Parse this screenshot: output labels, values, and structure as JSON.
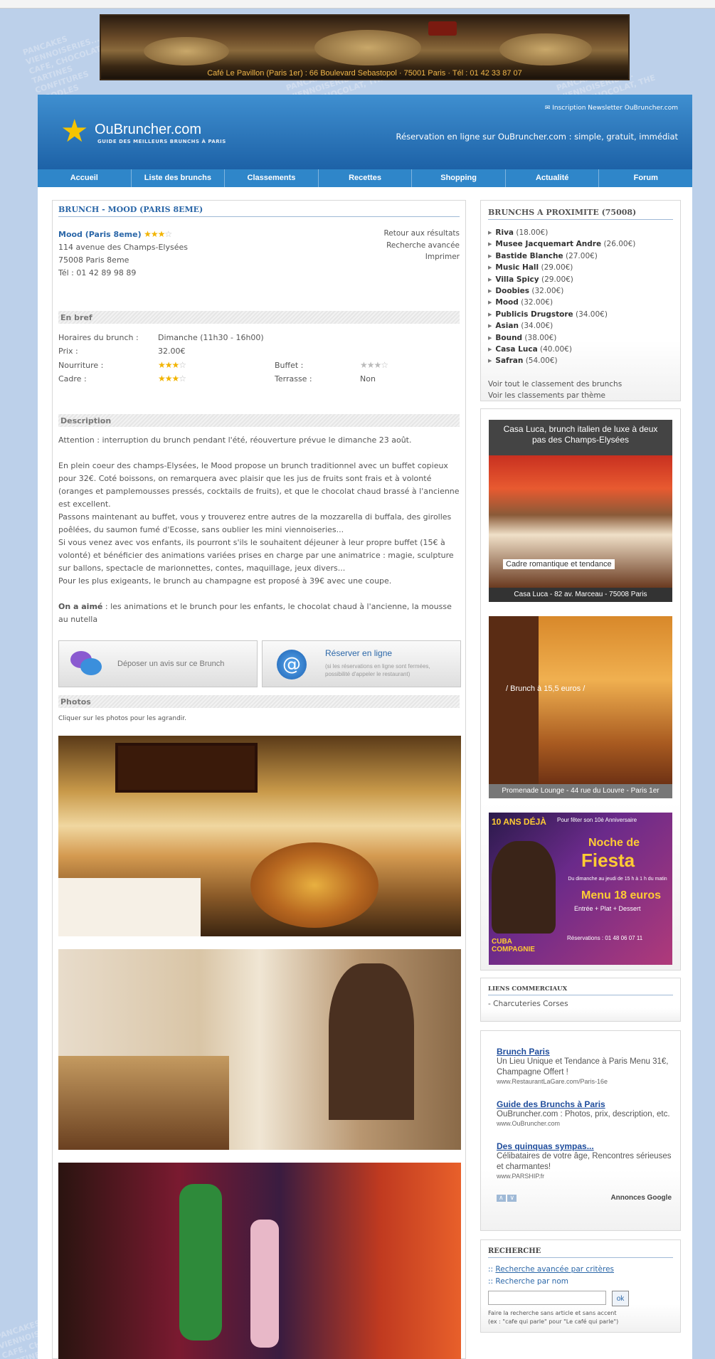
{
  "banner": {
    "caption": "Café Le Pavillon (Paris 1er) : 66 Boulevard Sebastopol · 75001 Paris · Tél : 01 42 33 87 07"
  },
  "background": {
    "words": "PANCAKES\nVIENNOISERIES...\nCAFE, CHOCOLAT, THE\nTARTINES\nCONFITURES\nNOODLES"
  },
  "header": {
    "logo": "OuBruncher.com",
    "logo_sub": "GUIDE DES MEILLEURS BRUNCHS À PARIS",
    "newsletter": "Inscription Newsletter OuBruncher.com",
    "tagline": "Réservation en ligne sur OuBruncher.com : simple, gratuit, immédiat"
  },
  "nav": [
    "Accueil",
    "Liste des brunchs",
    "Classements",
    "Recettes",
    "Shopping",
    "Actualité",
    "Forum"
  ],
  "main": {
    "title": "BRUNCH - MOOD (PARIS 8EME)",
    "name": "Mood (Paris 8eme)",
    "address1": "114 avenue des Champs-Elysées",
    "address2": "75008 Paris 8eme",
    "phone": "Tél : 01 42 89 98 89",
    "links": [
      "Retour aux résultats",
      "Recherche avancée",
      "Imprimer"
    ],
    "enbref": "En bref",
    "horaires_label": "Horaires du brunch :",
    "horaires": "Dimanche (11h30 - 16h00)",
    "prix_label": "Prix :",
    "prix": "32.00€",
    "nourriture_label": "Nourriture :",
    "buffet_label": "Buffet :",
    "cadre_label": "Cadre :",
    "terrasse_label": "Terrasse :",
    "terrasse": "Non",
    "description": "Description",
    "attention": "Attention : interruption du brunch pendant l'été, réouverture prévue le dimanche 23 août.",
    "p1": "En plein coeur des champs-Elysées, le Mood propose un brunch traditionnel avec un buffet copieux pour 32€. Coté boissons, on remarquera avec plaisir que les jus de fruits sont frais et à volonté (oranges et pamplemousses pressés, cocktails de fruits), et que le chocolat chaud brassé à l'ancienne est excellent.",
    "p2": "Passons maintenant au buffet, vous y trouverez entre autres de la mozzarella di buffala, des girolles poêlées, du saumon fumé d'Ecosse, sans oublier les mini viennoiseries...",
    "p3": "Si vous venez avec vos enfants, ils pourront s'ils le souhaitent déjeuner à leur propre buffet (15€ à volonté) et bénéficier des animations variées prises en charge par une animatrice : magie, sculpture sur ballons, spectacle de marionnettes, contes, maquillage, jeux divers...",
    "p4": "Pour les plus exigeants, le brunch au champagne est proposé à 39€ avec une coupe.",
    "aime_label": "On a aimé",
    "aime": " : les animations et le brunch pour les enfants, le chocolat chaud à l'ancienne, la mousse au nutella",
    "btn_avis": "Déposer un avis sur ce Brunch",
    "btn_reserver": "Réserver en ligne",
    "btn_reserver_sub": "(si les réservations en ligne sont fermées, possibilité d'appeler le restaurant)",
    "photos": "Photos",
    "photos_hint": "Cliquer sur les photos pour les agrandir."
  },
  "side": {
    "proxi_title": "BRUNCHS A PROXIMITE (75008)",
    "proxi": [
      {
        "n": "Riva",
        "p": "(18.00€)"
      },
      {
        "n": "Musee Jacquemart Andre",
        "p": "(26.00€)"
      },
      {
        "n": "Bastide Blanche",
        "p": "(27.00€)"
      },
      {
        "n": "Music Hall",
        "p": "(29.00€)"
      },
      {
        "n": "Villa Spicy",
        "p": "(29.00€)"
      },
      {
        "n": "Doobies",
        "p": "(32.00€)"
      },
      {
        "n": "Mood",
        "p": "(32.00€)"
      },
      {
        "n": "Publicis Drugstore",
        "p": "(34.00€)"
      },
      {
        "n": "Asian",
        "p": "(34.00€)"
      },
      {
        "n": "Bound",
        "p": "(38.00€)"
      },
      {
        "n": "Casa Luca",
        "p": "(40.00€)"
      },
      {
        "n": "Safran",
        "p": "(54.00€)"
      }
    ],
    "see_all": "Voir tout le classement des brunchs",
    "see_theme": "Voir les classements par thème",
    "ad1_title": "Casa Luca, brunch italien de luxe à deux pas des Champs-Elysées",
    "ad1_caption": "Cadre romantique et tendance",
    "ad1_footer": "Casa Luca - 82 av. Marceau - 75008 Paris",
    "ad2_caption": "/ Brunch à 15,5 euros /",
    "ad2_footer": "Promenade Lounge - 44 rue du Louvre - Paris 1er",
    "ad3_top": "Pour fêter son 10è Anniversaire",
    "ad3_10": "10 ANS DÉJÀ",
    "ad3_noche": "Noche de",
    "ad3_fiesta": "Fiesta",
    "ad3_dates": "Du dimanche au jeudi de 15 h à 1 h du matin",
    "ad3_menu": "Menu 18 euros",
    "ad3_menu_sub": "Entrée + Plat + Dessert",
    "ad3_brand": "CUBA COMPAGNIE",
    "ad3_resa": "Réservations : 01 48 06 07 11",
    "liens_title": "LIENS COMMERCIAUX",
    "liens_item": "- Charcuteries Corses",
    "google_ads": [
      {
        "t": "Brunch Paris",
        "d": "Un Lieu Unique et Tendance à Paris Menu 31€, Champagne Offert !",
        "u": "www.RestaurantLaGare.com/Paris-16e"
      },
      {
        "t": "Guide des Brunchs à Paris",
        "d": "OuBruncher.com : Photos, prix, description, etc.",
        "u": "www.OuBruncher.com"
      },
      {
        "t": "Des quinquas sympas...",
        "d": "Célibataires de votre âge, Rencontres sérieuses et charmantes!",
        "u": "www.PARSHIP.fr"
      }
    ],
    "annonces": "Annonces Google",
    "recherche_title": "RECHERCHE",
    "recherche_adv": "Recherche avancée par critères",
    "recherche_nom": "Recherche par nom",
    "ok": "ok",
    "hint1": "Faire la recherche sans article et sans accent",
    "hint2": "(ex : \"cafe qui parle\" pour \"Le café qui parle\")"
  },
  "colors": {
    "brand": "#2b67a8",
    "nav": "#2f86c9",
    "star": "#f2b400"
  }
}
